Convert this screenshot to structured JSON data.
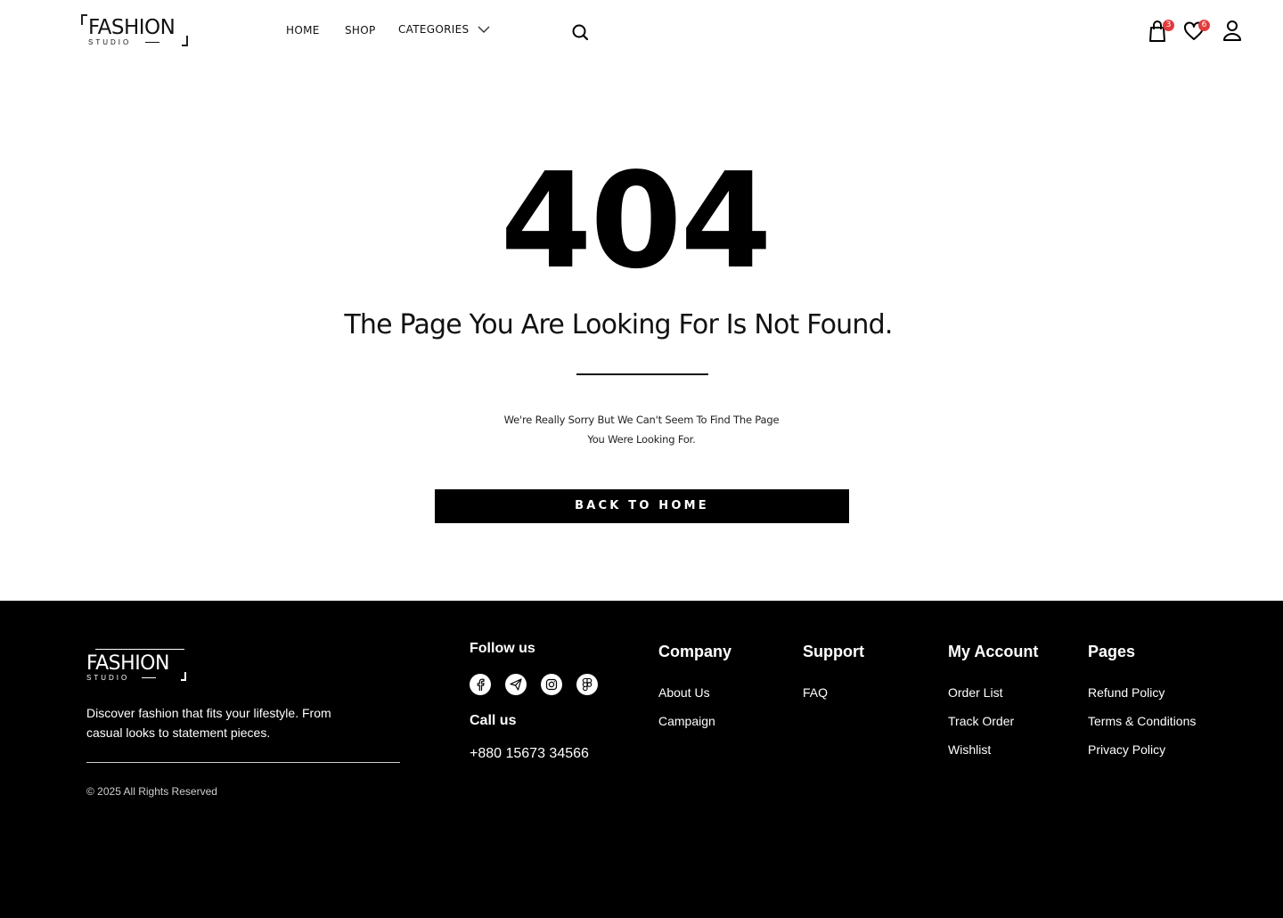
{
  "header": {
    "logo": {
      "word": "FASHION",
      "sub": "STUDIO"
    },
    "nav": {
      "home": "HOME",
      "shop": "SHOP",
      "categories": "CATEGORIES"
    },
    "cart_count": "3",
    "wishlist_count": "6",
    "icons": [
      "search-icon",
      "shopping-bag-icon",
      "heart-icon",
      "user-icon",
      "chevron-down-icon"
    ]
  },
  "main": {
    "code": "404",
    "headline": "The Page You Are Looking For Is Not Found.",
    "message_line1": "We're Really Sorry But We Can't Seem To Find The Page",
    "message_line2": "You Were Looking For.",
    "back_button": "BACK TO HOME"
  },
  "footer": {
    "logo": {
      "word": "FASHION",
      "sub": "STUDIO"
    },
    "description": "Discover fashion that fits your lifestyle. From casual looks to statement pieces.",
    "copyright": "© 2025 All Rights Reserved",
    "follow_title": "Follow us",
    "socials": [
      "facebook-icon",
      "telegram-icon",
      "instagram-icon",
      "figma-icon"
    ],
    "call_title": "Call us",
    "phone": "+880 15673 34566",
    "company": {
      "title": "Company",
      "links": [
        "About Us",
        "Campaign"
      ]
    },
    "support": {
      "title": "Support",
      "links": [
        "FAQ"
      ]
    },
    "account": {
      "title": "My Account",
      "links": [
        "Order List",
        "Track Order",
        "Wishlist"
      ]
    },
    "pages": {
      "title": "Pages",
      "links": [
        "Refund Policy",
        "Terms & Conditions",
        "Privacy Policy"
      ]
    }
  }
}
